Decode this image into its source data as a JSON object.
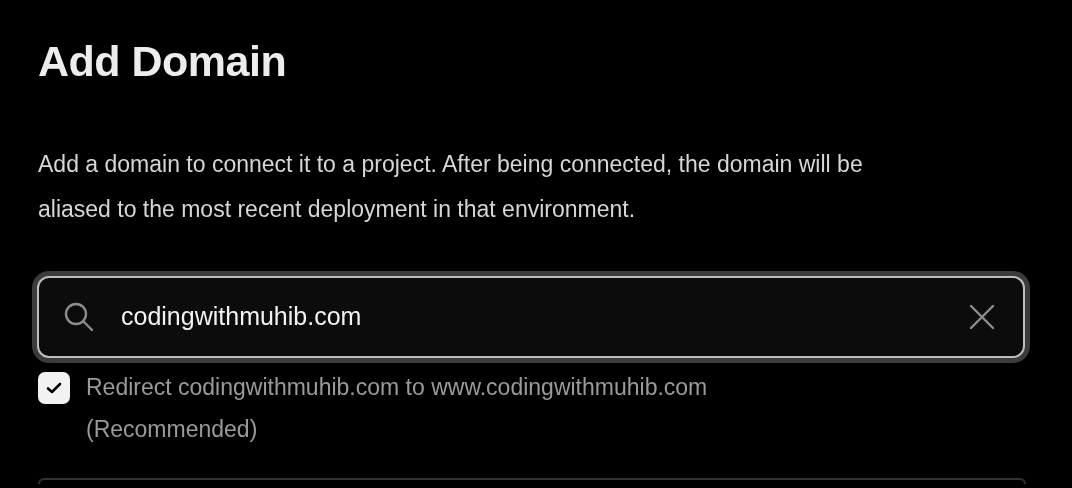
{
  "title": "Add Domain",
  "description": "Add a domain to connect it to a project. After being connected, the domain will be aliased to the most recent deployment in that environment.",
  "domain_field": {
    "value": "codingwithmuhib.com",
    "focused": true
  },
  "redirect_option": {
    "label": "Redirect codingwithmuhib.com to www.codingwithmuhib.com (Recommended)",
    "checked": true
  }
}
